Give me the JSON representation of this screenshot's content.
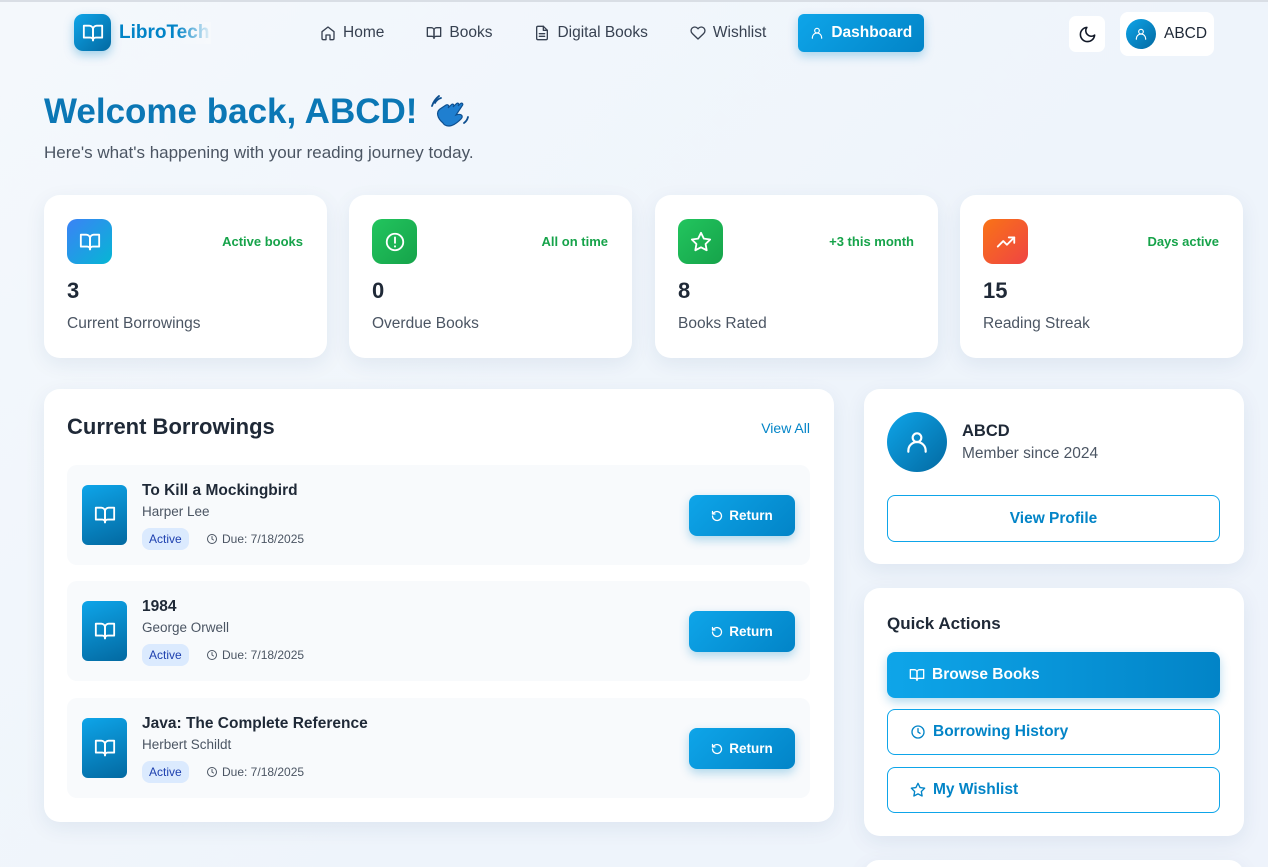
{
  "nav": {
    "brand": "LibroTech",
    "links": [
      {
        "label": "Home",
        "icon": "home-icon"
      },
      {
        "label": "Books",
        "icon": "book-icon"
      },
      {
        "label": "Digital Books",
        "icon": "file-icon"
      },
      {
        "label": "Wishlist",
        "icon": "heart-icon"
      },
      {
        "label": "Dashboard",
        "icon": "user-icon",
        "active": true
      }
    ],
    "theme_icon": "moon-icon",
    "user_name": "ABCD"
  },
  "welcome": {
    "title": "Welcome back, ABCD!",
    "emoji": "waving-hand",
    "subtitle": "Here's what's happening with your reading journey today."
  },
  "stats": [
    {
      "icon": "book-open-icon",
      "tag": "Active books",
      "value": "3",
      "label": "Current Borrowings",
      "color": "#3b82f6"
    },
    {
      "icon": "alert-circle-icon",
      "tag": "All on time",
      "value": "0",
      "label": "Overdue Books",
      "color": "#22c55e"
    },
    {
      "icon": "star-icon",
      "tag": "+3 this month",
      "value": "8",
      "label": "Books Rated",
      "color": "#22c55e"
    },
    {
      "icon": "trending-up-icon",
      "tag": "Days active",
      "value": "15",
      "label": "Reading Streak",
      "color": "#f97316"
    }
  ],
  "borrowings": {
    "title": "Current Borrowings",
    "view_all": "View All",
    "items": [
      {
        "title": "To Kill a Mockingbird",
        "author": "Harper Lee",
        "status": "Active",
        "due": "Due: 7/18/2025",
        "action": "Return"
      },
      {
        "title": "1984",
        "author": "George Orwell",
        "status": "Active",
        "due": "Due: 7/18/2025",
        "action": "Return"
      },
      {
        "title": "Java: The Complete Reference",
        "author": "Herbert Schildt",
        "status": "Active",
        "due": "Due: 7/18/2025",
        "action": "Return"
      }
    ]
  },
  "profile": {
    "name": "ABCD",
    "since": "Member since 2024",
    "button": "View Profile"
  },
  "quick_actions": {
    "title": "Quick Actions",
    "items": [
      {
        "label": "Browse Books",
        "icon": "book-icon"
      },
      {
        "label": "Borrowing History",
        "icon": "clock-icon"
      },
      {
        "label": "My Wishlist",
        "icon": "star-icon"
      }
    ]
  },
  "colors": {
    "accent": "#0284c7",
    "accent_light": "#0ea5e9",
    "success": "#16a34a",
    "badge_bg": "#dbeafe"
  }
}
